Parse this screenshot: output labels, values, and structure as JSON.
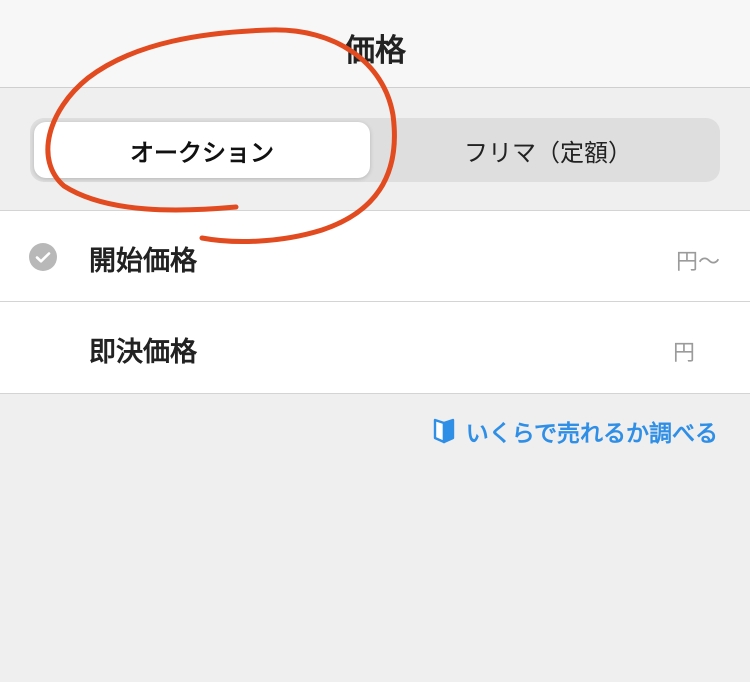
{
  "header": {
    "title": "価格"
  },
  "segmented_control": {
    "auction_label": "オークション",
    "flea_label": "フリマ（定額）",
    "selected": "auction"
  },
  "form": {
    "start_price": {
      "label": "開始価格",
      "unit": "円〜",
      "checked": true
    },
    "buyout_price": {
      "label": "即決価格",
      "unit": "円"
    }
  },
  "link": {
    "label": "いくらで売れるか調べる",
    "icon": "beginner-mark-icon"
  },
  "colors": {
    "accent": "#2f8fe6",
    "annotation": "#e24a1f",
    "background": "#efeff0",
    "header_background": "#f7f7f7",
    "segment_background": "#dedede"
  },
  "icons": {
    "checkmark": "check-circle-icon",
    "annotation_mark": "red-circle-mark"
  }
}
